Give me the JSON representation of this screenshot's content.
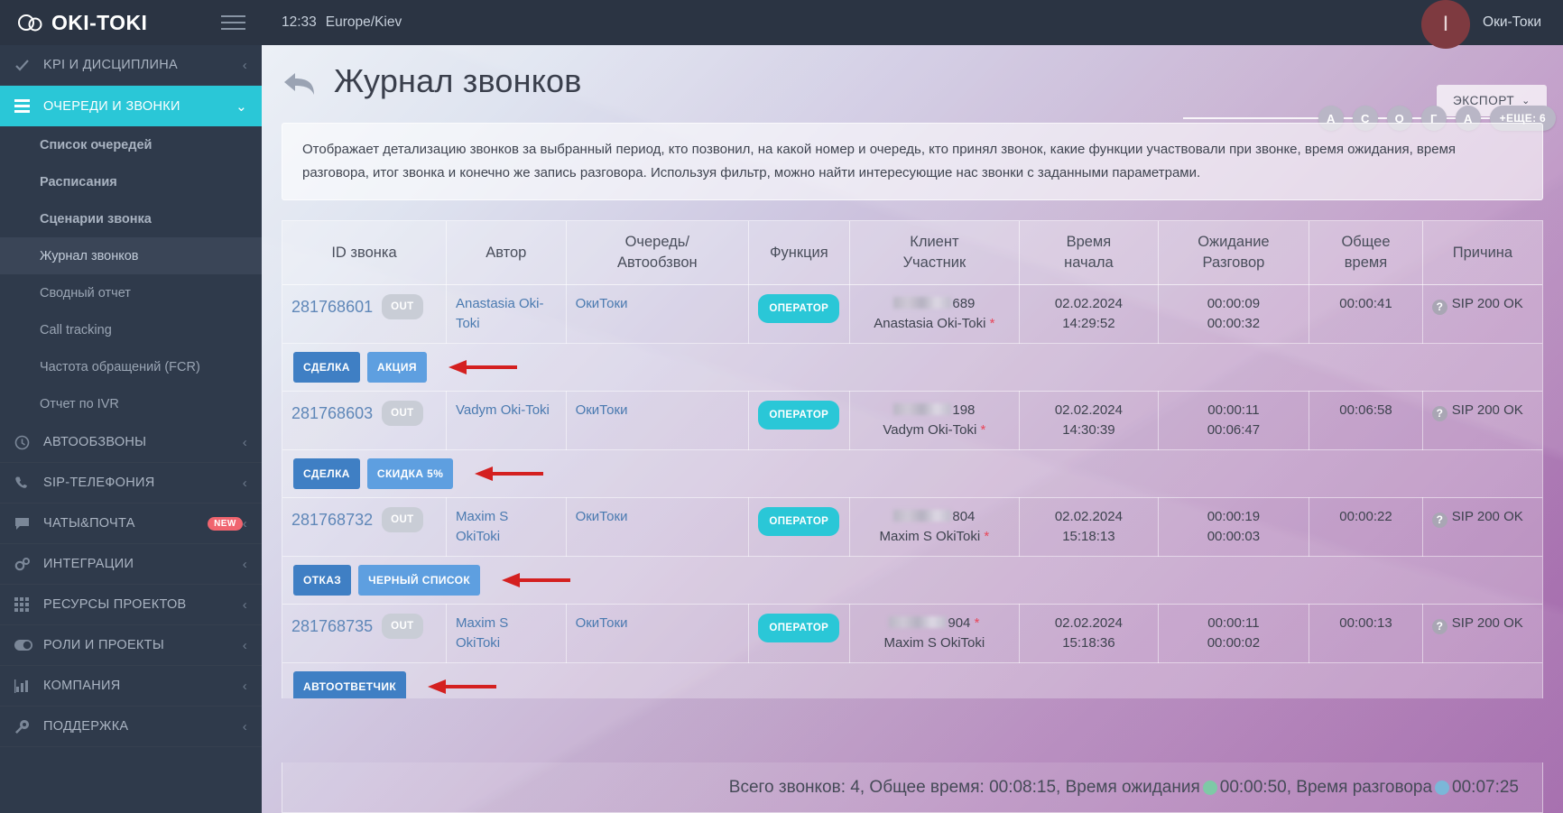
{
  "brand": {
    "name": "OKI-TOKI",
    "logo_icon": "cloud-icon",
    "menu_icon": "hamburger-icon"
  },
  "topbar": {
    "time": "12:33",
    "timezone": "Europe/Kiev",
    "avatar_letter": "I",
    "username": "Оки-Токи"
  },
  "sidebar": {
    "sections": [
      {
        "label": "KPI И ДИСЦИПЛИНА",
        "icon": "check-icon",
        "chevron": "‹",
        "active": false
      },
      {
        "label": "ОЧЕРЕДИ И ЗВОНКИ",
        "icon": "list-icon",
        "chevron": "⌄",
        "active": true
      },
      {
        "label": "АВТООБЗВОНЫ",
        "icon": "clock-icon",
        "chevron": "‹",
        "active": false
      },
      {
        "label": "SIP-ТЕЛЕФОНИЯ",
        "icon": "phone-icon",
        "chevron": "‹",
        "active": false
      },
      {
        "label": "ЧАТЫ&ПОЧТА",
        "icon": "chat-icon",
        "chevron": "‹",
        "badge": "NEW",
        "active": false
      },
      {
        "label": "ИНТЕГРАЦИИ",
        "icon": "gears-icon",
        "chevron": "‹",
        "active": false
      },
      {
        "label": "РЕСУРСЫ ПРОЕКТОВ",
        "icon": "grid-icon",
        "chevron": "‹",
        "active": false
      },
      {
        "label": "РОЛИ И ПРОЕКТЫ",
        "icon": "toggle-icon",
        "chevron": "‹",
        "active": false
      },
      {
        "label": "КОМПАНИЯ",
        "icon": "bars-chart-icon",
        "chevron": "‹",
        "active": false
      },
      {
        "label": "ПОДДЕРЖКА",
        "icon": "wrench-icon",
        "chevron": "‹",
        "active": false
      }
    ],
    "submenu": [
      {
        "label": "Список очередей",
        "bold": true,
        "current": false
      },
      {
        "label": "Расписания",
        "bold": true,
        "current": false
      },
      {
        "label": "Сценарии звонка",
        "bold": true,
        "current": false
      },
      {
        "label": "Журнал звонков",
        "bold": false,
        "current": true
      },
      {
        "label": "Сводный отчет",
        "bold": false,
        "current": false
      },
      {
        "label": "Call tracking",
        "bold": false,
        "current": false
      },
      {
        "label": "Частота обращений (FCR)",
        "bold": false,
        "current": false
      },
      {
        "label": "Отчет по IVR",
        "bold": false,
        "current": false
      }
    ]
  },
  "page": {
    "title": "Журнал звонков",
    "back_icon": "back-arrow-icon",
    "export_label": "ЭКСПОРТ",
    "export_chevron": "⌄",
    "description": "Отображает детализацию звонков за выбранный период, кто позвонил, на какой номер и очередь, кто принял звонок, какие функции участвовали при звонке, время ожидания, время разговора, итог звонка и конечно же запись разговора. Используя фильтр, можно найти интересующие нас звонки с заданными параметрами."
  },
  "letter_badges": {
    "items": [
      "А",
      "С",
      "О",
      "Г",
      "А"
    ],
    "more_label": "+ЕЩЕ: 6"
  },
  "table": {
    "columns": [
      "ID звонка",
      "Автор",
      "Очередь/\nАвтообзвон",
      "Функция",
      "Клиент\nУчастник",
      "Время\nначала",
      "Ожидание\nРазговор",
      "Общее\nвремя",
      "Причина"
    ],
    "columns_split": [
      {
        "l1": "ID звонка",
        "l2": ""
      },
      {
        "l1": "Автор",
        "l2": ""
      },
      {
        "l1": "Очередь/",
        "l2": "Автообзвон"
      },
      {
        "l1": "Функция",
        "l2": ""
      },
      {
        "l1": "Клиент",
        "l2": "Участник"
      },
      {
        "l1": "Время",
        "l2": "начала"
      },
      {
        "l1": "Ожидание",
        "l2": "Разговор"
      },
      {
        "l1": "Общее",
        "l2": "время"
      },
      {
        "l1": "Причина",
        "l2": ""
      }
    ],
    "rows": [
      {
        "id": "281768601",
        "direction": "OUT",
        "author": "Anastasia Oki-Toki",
        "queue": "ОкиТоки",
        "function": "ОПЕРАТОР",
        "client_number": "689",
        "client_name": "Anastasia Oki-Toki",
        "client_star": "*",
        "start_date": "02.02.2024",
        "start_time": "14:29:52",
        "wait": "00:00:09",
        "talk": "00:00:32",
        "total": "00:00:41",
        "reason": "SIP 200 OK",
        "tags": [
          {
            "label": "СДЕЛКА",
            "style": "dark"
          },
          {
            "label": "АКЦИЯ",
            "style": "light"
          }
        ]
      },
      {
        "id": "281768603",
        "direction": "OUT",
        "author": "Vadym Oki-Toki",
        "queue": "ОкиТоки",
        "function": "ОПЕРАТОР",
        "client_number": "198",
        "client_name": "Vadym Oki-Toki",
        "client_star": "*",
        "start_date": "02.02.2024",
        "start_time": "14:30:39",
        "wait": "00:00:11",
        "talk": "00:06:47",
        "total": "00:06:58",
        "reason": "SIP 200 OK",
        "tags": [
          {
            "label": "СДЕЛКА",
            "style": "dark"
          },
          {
            "label": "СКИДКА 5%",
            "style": "light"
          }
        ]
      },
      {
        "id": "281768732",
        "direction": "OUT",
        "author": "Maxim S OkiToki",
        "queue": "ОкиТоки",
        "function": "ОПЕРАТОР",
        "client_number": "804",
        "client_name": "Maxim S OkiToki",
        "client_star": "*",
        "start_date": "02.02.2024",
        "start_time": "15:18:13",
        "wait": "00:00:19",
        "talk": "00:00:03",
        "total": "00:00:22",
        "reason": "SIP 200 OK",
        "tags": [
          {
            "label": "ОТКАЗ",
            "style": "dark"
          },
          {
            "label": "ЧЕРНЫЙ СПИСОК",
            "style": "light"
          }
        ]
      },
      {
        "id": "281768735",
        "direction": "OUT",
        "author": "Maxim S OkiToki",
        "queue": "ОкиТоки",
        "function": "ОПЕРАТОР",
        "client_number": "904",
        "client_name": "Maxim S OkiToki",
        "client_star": "*",
        "start_date": "02.02.2024",
        "start_time": "15:18:36",
        "wait": "00:00:11",
        "talk": "00:00:02",
        "total": "00:00:13",
        "reason": "SIP 200 OK",
        "tags": [
          {
            "label": "АВТООТВЕТЧИК",
            "style": "dark"
          }
        ]
      }
    ]
  },
  "totals": {
    "calls_label": "Всего звонков:",
    "calls_value": "4",
    "total_time_label": "Общее время:",
    "total_time_value": "00:08:15",
    "wait_label": "Время ожидания",
    "wait_value": "00:00:50",
    "talk_label": "Время разговора",
    "talk_value": "00:07:25"
  },
  "colors": {
    "accent_cyan": "#2ac7d7",
    "sidebar_bg": "#2f3a4b",
    "topbar_bg": "#2b3443",
    "tag_dark": "#3f7fc4",
    "tag_light": "#5e9fe0",
    "annotation_red": "#d42020",
    "badge_new": "#f0656f"
  }
}
